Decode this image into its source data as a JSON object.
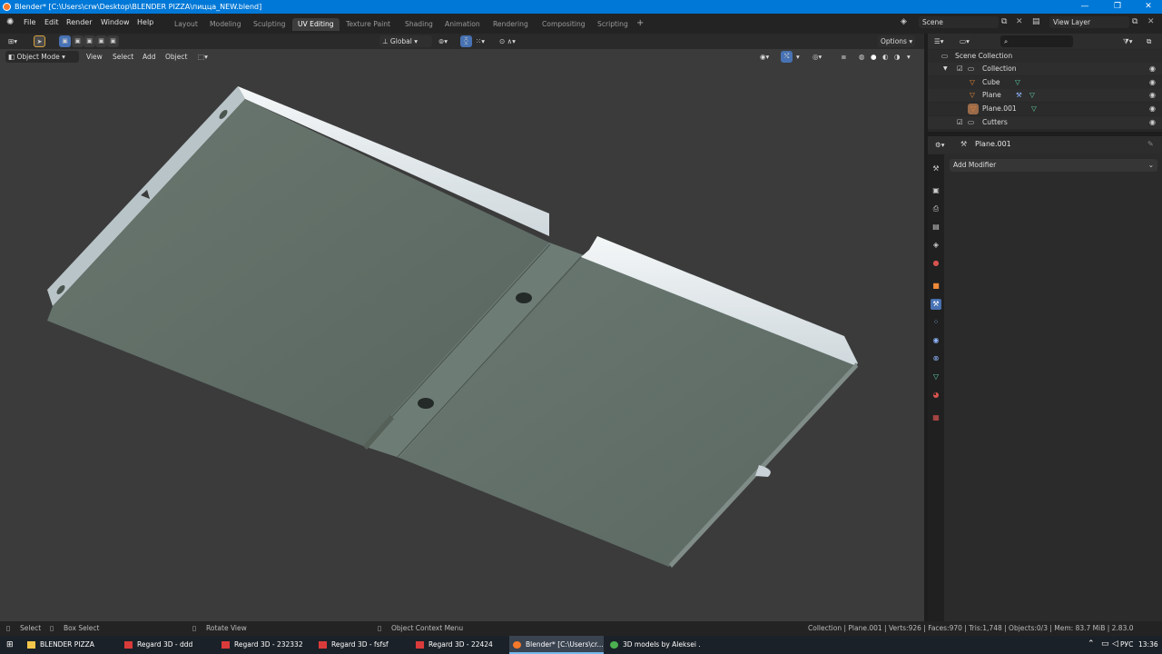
{
  "window": {
    "title": "Blender* [C:\\Users\\crw\\Desktop\\BLENDER PIZZA\\пицца_NEW.blend]"
  },
  "menus": [
    "File",
    "Edit",
    "Render",
    "Window",
    "Help"
  ],
  "workspaces": [
    {
      "label": "Layout"
    },
    {
      "label": "Modeling"
    },
    {
      "label": "Sculpting"
    },
    {
      "label": "UV Editing",
      "active": true
    },
    {
      "label": "Texture Paint"
    },
    {
      "label": "Shading"
    },
    {
      "label": "Animation"
    },
    {
      "label": "Rendering"
    },
    {
      "label": "Compositing"
    },
    {
      "label": "Scripting"
    }
  ],
  "scene": {
    "label": "Scene"
  },
  "view_layer": {
    "label": "View Layer"
  },
  "viewport": {
    "transform_orientation": "Global",
    "options_label": "Options",
    "mode": "Object Mode",
    "header_menus": [
      "View",
      "Select",
      "Add",
      "Object"
    ]
  },
  "outliner": {
    "root": "Scene Collection",
    "items": [
      {
        "label": "Collection"
      },
      {
        "label": "Cube"
      },
      {
        "label": "Plane"
      },
      {
        "label": "Plane.001"
      },
      {
        "label": "Cutters"
      }
    ]
  },
  "properties": {
    "object_name": "Plane.001",
    "add_modifier": "Add Modifier"
  },
  "status": {
    "select": "Select",
    "box_select": "Box Select",
    "rotate_view": "Rotate View",
    "context_menu": "Object Context Menu",
    "stats": "Collection | Plane.001 | Verts:926 | Faces:970 | Tris:1,748 | Objects:0/3 | Mem: 83.7 MiB | 2.83.0"
  },
  "taskbar": {
    "items": [
      {
        "label": "BLENDER PIZZA",
        "icon": "folder-icon",
        "color": "#f2c64b"
      },
      {
        "label": "Regard 3D - ddd",
        "icon": "regard-icon",
        "color": "#d93b3b"
      },
      {
        "label": "Regard 3D - 232332",
        "icon": "regard-icon",
        "color": "#d93b3b"
      },
      {
        "label": "Regard 3D - fsfsf",
        "icon": "regard-icon",
        "color": "#d93b3b"
      },
      {
        "label": "Regard 3D - 22424",
        "icon": "regard-icon",
        "color": "#d93b3b"
      },
      {
        "label": "Blender* [C:\\Users\\cr...",
        "icon": "blender-icon",
        "color": "#f5792a",
        "active": true
      },
      {
        "label": "3D models by Aleksei ...",
        "icon": "chrome-icon",
        "color": "#4caf50"
      }
    ],
    "lang": "РУС",
    "time": "13:36"
  }
}
